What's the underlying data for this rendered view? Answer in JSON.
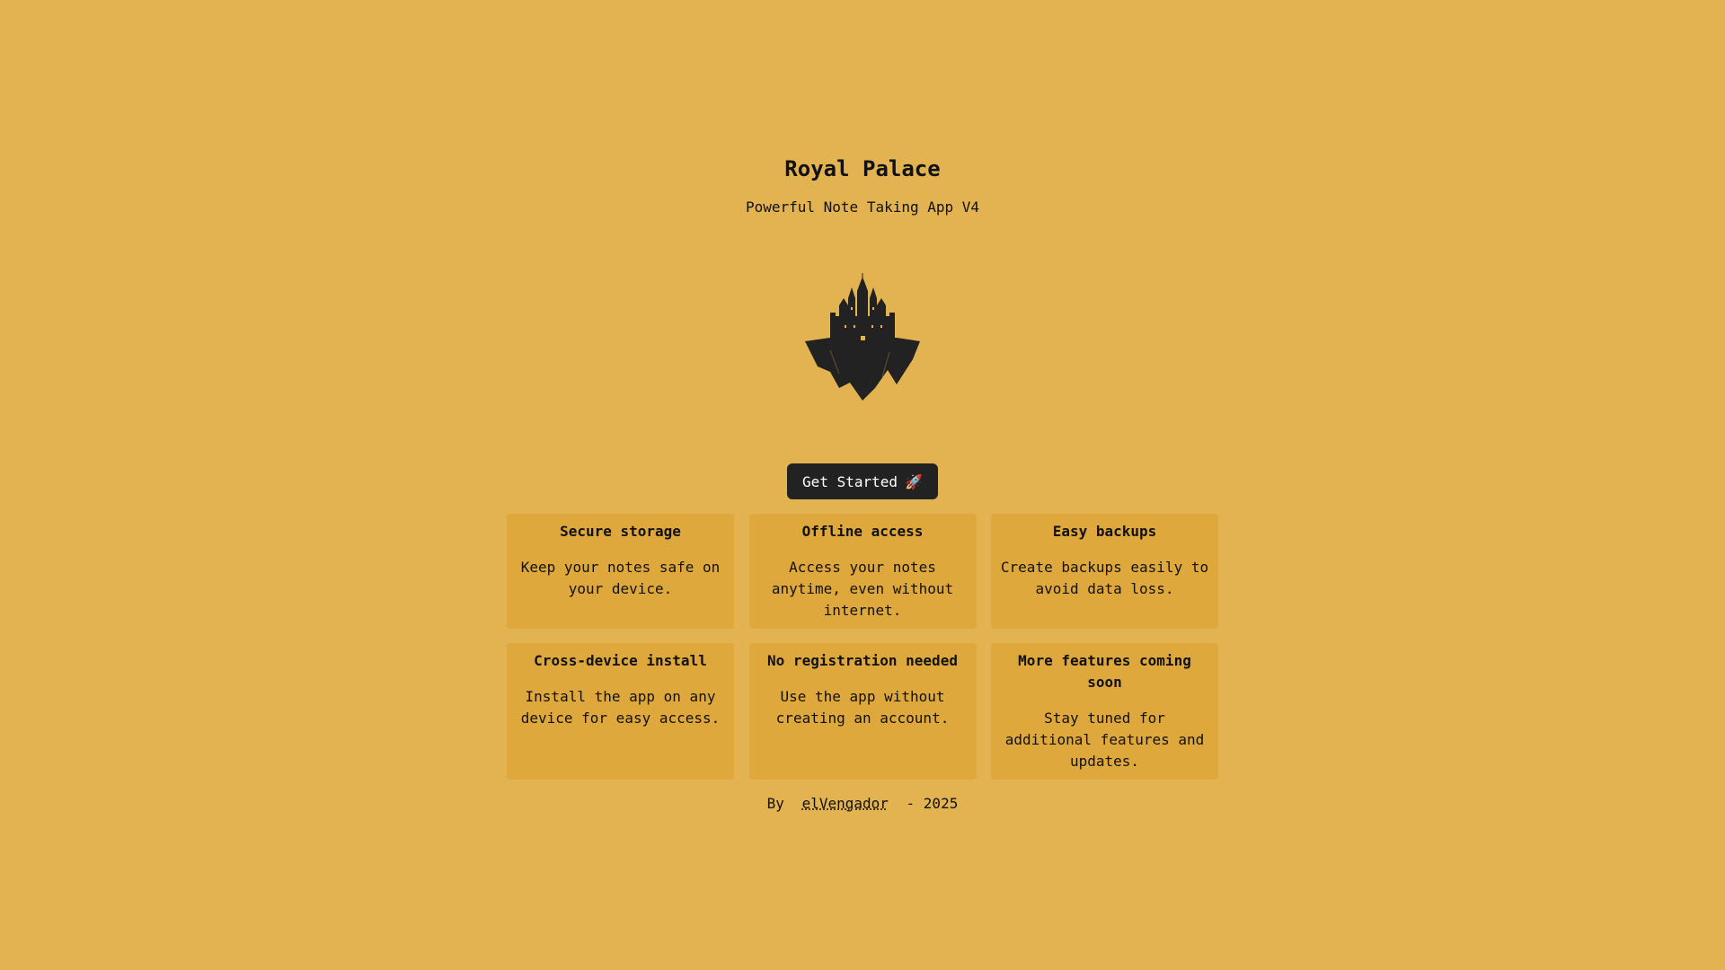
{
  "header": {
    "title": "Royal Palace",
    "subtitle": "Powerful Note Taking App V4"
  },
  "logo": {
    "icon": "castle-icon",
    "color": "#222222"
  },
  "cta": {
    "label": "Get Started",
    "icon_glyph": "🚀"
  },
  "features": [
    {
      "title": "Secure storage",
      "description": "Keep your notes safe on your device."
    },
    {
      "title": "Offline access",
      "description": "Access your notes anytime, even without internet."
    },
    {
      "title": "Easy backups",
      "description": "Create backups easily to avoid data loss."
    },
    {
      "title": "Cross-device install",
      "description": "Install the app on any device for easy access."
    },
    {
      "title": "No registration needed",
      "description": "Use the app without creating an account."
    },
    {
      "title": "More features coming soon",
      "description": "Stay tuned for additional features and updates."
    }
  ],
  "footer": {
    "prefix": "By",
    "author": "elVengador",
    "suffix": "- 2025"
  },
  "colors": {
    "background": "#e2b350",
    "card": "#dfa83c",
    "button": "#222222"
  }
}
